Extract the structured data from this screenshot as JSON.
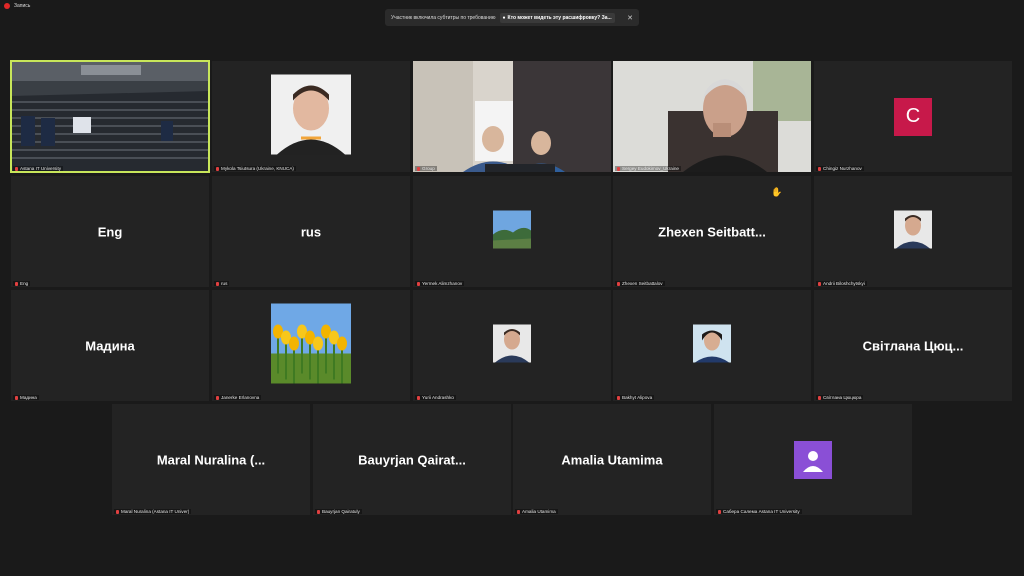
{
  "recording": {
    "label": "Запись"
  },
  "banner": {
    "text": "Участник включила субтитры по требованию",
    "question": "Кто может видеть эту расшифровку? За..."
  },
  "participants": [
    {
      "label": "Astana IT University",
      "display": "",
      "kind": "video-hall",
      "active": true
    },
    {
      "label": "Mykola Tsiutsura (Ukraine, KNUCA)",
      "display": "",
      "kind": "photo-man"
    },
    {
      "label": "Group",
      "display": "",
      "kind": "video-panel"
    },
    {
      "label": "Sergey Eudokimov_Ukraine",
      "display": "",
      "kind": "video-man"
    },
    {
      "label": "Chingiz Nurzhanov",
      "display": "C",
      "kind": "letter",
      "color": "#c7194a"
    },
    {
      "label": "Eng",
      "display": "Eng",
      "kind": "name"
    },
    {
      "label": "rus",
      "display": "rus",
      "kind": "name"
    },
    {
      "label": "Yermek Alimzhanov",
      "display": "",
      "kind": "photo-landscape"
    },
    {
      "label": "Zhexen Seitbattalov",
      "display": "Zhexen  Seitbatt...",
      "kind": "name"
    },
    {
      "label": "Andrii Biloshchytskyi",
      "display": "",
      "kind": "photo-small"
    },
    {
      "label": "Мадина",
      "display": "Мадина",
      "kind": "name"
    },
    {
      "label": "Janerke Erlanovna",
      "display": "",
      "kind": "photo-tulips"
    },
    {
      "label": "Yurii Andrashko",
      "display": "",
      "kind": "photo-small"
    },
    {
      "label": "Bakhyt Alipova",
      "display": "",
      "kind": "photo-woman"
    },
    {
      "label": "Світлана Цюцюра",
      "display": "Світлана  Цюц...",
      "kind": "name"
    },
    {
      "label": "Maral Nuralina (Astana IT Univer)",
      "display": "Maral  Nuralina  (...",
      "kind": "name"
    },
    {
      "label": "Bauyrjan Qairatuly",
      "display": "Bauyrjan  Qairat...",
      "kind": "name"
    },
    {
      "label": "Amalia Utamima",
      "display": "Amalia  Utamima",
      "kind": "name"
    },
    {
      "label": "Сабера Салема Astana IT University",
      "display": "",
      "kind": "purple-avatar"
    }
  ]
}
